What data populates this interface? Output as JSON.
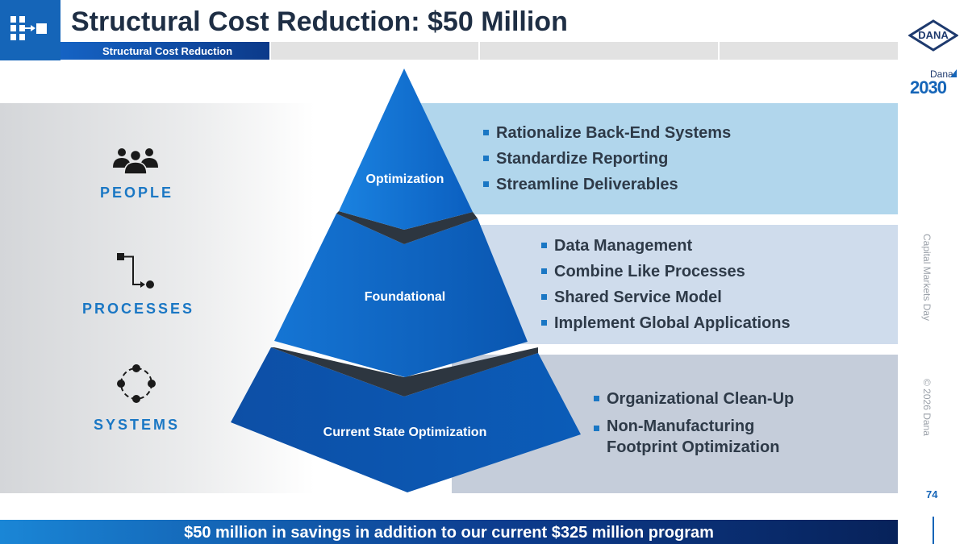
{
  "header": {
    "title": "Structural Cost Reduction: $50 Million",
    "active_tab": "Structural Cost Reduction"
  },
  "logos": {
    "brand": "DANA",
    "program_brand": "Dana",
    "program_year": "2030"
  },
  "categories": [
    {
      "label": "PEOPLE",
      "icon": "people-icon"
    },
    {
      "label": "PROCESSES",
      "icon": "process-flow-icon"
    },
    {
      "label": "SYSTEMS",
      "icon": "systems-cycle-icon"
    }
  ],
  "tiers": [
    {
      "label": "Optimization",
      "bullets": [
        "Rationalize Back-End Systems",
        "Standardize Reporting",
        "Streamline Deliverables"
      ]
    },
    {
      "label": "Foundational",
      "bullets": [
        "Data Management",
        "Combine Like Processes",
        "Shared Service Model",
        "Implement Global Applications"
      ]
    },
    {
      "label": "Current State Optimization",
      "bullets": [
        "Organizational Clean-Up",
        "Non-Manufacturing Footprint Optimization"
      ]
    }
  ],
  "sidebar": {
    "event": "Capital Markets Day",
    "copyright": "© 2026 Dana"
  },
  "page_number": "74",
  "footer": {
    "message": "$50 million in savings in addition to our current $325 million program"
  },
  "colors": {
    "accent": "#1565b8",
    "title": "#1e2e44",
    "category": "#1a77c4"
  }
}
